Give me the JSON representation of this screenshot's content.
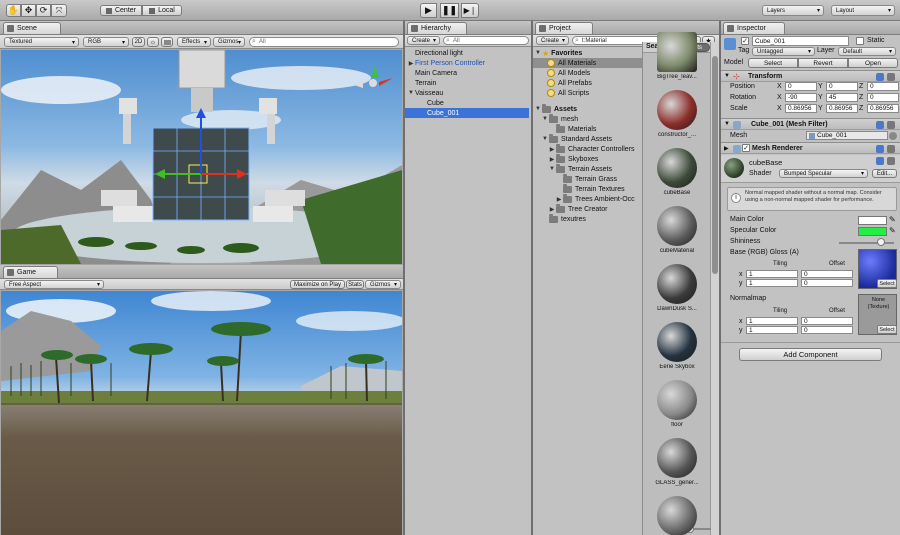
{
  "toolbar": {
    "center_btn": "Center",
    "local_btn": "Local",
    "layers": "Layers",
    "layout": "Layout"
  },
  "scene": {
    "tab": "Scene",
    "shading": "Textured",
    "render_mode": "RGB",
    "mode_2d": "2D",
    "effects": "Effects",
    "gizmos": "Gizmos",
    "search_placeholder": "All"
  },
  "game": {
    "tab": "Game",
    "aspect": "Free Aspect",
    "maximize": "Maximize on Play",
    "stats": "Stats",
    "gizmos": "Gizmos"
  },
  "hierarchy": {
    "tab": "Hierarchy",
    "create": "Create",
    "search_placeholder": "All",
    "items": [
      {
        "label": "Directional light",
        "indent": 0,
        "arrow": "",
        "blue": false
      },
      {
        "label": "First Person Controller",
        "indent": 0,
        "arrow": "▶",
        "blue": true
      },
      {
        "label": "Main Camera",
        "indent": 0,
        "arrow": "",
        "blue": false
      },
      {
        "label": "Terrain",
        "indent": 0,
        "arrow": "",
        "blue": false
      },
      {
        "label": "Vaisseau",
        "indent": 0,
        "arrow": "▼",
        "blue": false
      },
      {
        "label": "Cube",
        "indent": 1,
        "arrow": "",
        "blue": false
      },
      {
        "label": "Cube_001",
        "indent": 1,
        "arrow": "",
        "blue": false,
        "selected": true
      }
    ]
  },
  "project": {
    "tab": "Project",
    "create": "Create",
    "search_value": "t:Material",
    "search_label": "Search:",
    "assets_btn": "Assets",
    "favorites_label": "Favorites",
    "favorites": [
      "All Materials",
      "All Models",
      "All Prefabs",
      "All Scripts"
    ],
    "assets_label": "Assets",
    "tree": [
      {
        "label": "mesh",
        "indent": 1,
        "arrow": "▼"
      },
      {
        "label": "Materials",
        "indent": 2,
        "arrow": ""
      },
      {
        "label": "Standard Assets",
        "indent": 1,
        "arrow": "▼"
      },
      {
        "label": "Character Controllers",
        "indent": 2,
        "arrow": "▶"
      },
      {
        "label": "Skyboxes",
        "indent": 2,
        "arrow": "▶"
      },
      {
        "label": "Terrain Assets",
        "indent": 2,
        "arrow": "▼"
      },
      {
        "label": "Terrain Grass",
        "indent": 3,
        "arrow": ""
      },
      {
        "label": "Terrain Textures",
        "indent": 3,
        "arrow": ""
      },
      {
        "label": "Trees Ambient-Occ",
        "indent": 3,
        "arrow": "▶"
      },
      {
        "label": "Tree Creator",
        "indent": 2,
        "arrow": "▶"
      },
      {
        "label": "texutres",
        "indent": 1,
        "arrow": ""
      }
    ],
    "results": [
      {
        "label": "BigTree_leav...",
        "color": "#7e8a6a"
      },
      {
        "label": "constructor_...",
        "color": "#8b2e2a"
      },
      {
        "label": "cubeBase",
        "color": "#3d4a3a"
      },
      {
        "label": "cubeMaterial",
        "color": "#5d5d5d"
      },
      {
        "label": "DawnDusk S...",
        "color": "#3b3b3b"
      },
      {
        "label": "Eerie Skybox",
        "color": "#243240"
      },
      {
        "label": "floor",
        "color": "#8a8a8a"
      },
      {
        "label": "GLASS_gener...",
        "color": "#555555"
      },
      {
        "label": "",
        "color": "#6a6a6a"
      }
    ]
  },
  "inspector": {
    "tab": "Inspector",
    "object_name": "Cube_001",
    "static_label": "Static",
    "tag_label": "Tag",
    "tag_value": "Untagged",
    "layer_label": "Layer",
    "layer_value": "Default",
    "model_label": "Model",
    "select_btn": "Select",
    "revert_btn": "Revert",
    "open_btn": "Open",
    "transform": {
      "title": "Transform",
      "rows": [
        {
          "label": "Position",
          "x": "0",
          "y": "0",
          "z": "0"
        },
        {
          "label": "Rotation",
          "x": "-90",
          "y": "45",
          "z": "0"
        },
        {
          "label": "Scale",
          "x": "0.86956",
          "y": "0.86956",
          "z": "0.86956"
        }
      ]
    },
    "mesh_filter": {
      "title": "Cube_001 (Mesh Filter)",
      "mesh_label": "Mesh",
      "mesh_value": "Cube_001"
    },
    "mesh_renderer": {
      "title": "Mesh Renderer"
    },
    "material": {
      "name": "cubeBase",
      "shader_label": "Shader",
      "shader_value": "Bumped Specular",
      "edit_btn": "Edit...",
      "info": "Normal mapped shader without a normal map. Consider using a non-normal mapped shader for performance.",
      "main_color": "Main Color",
      "specular_color": "Specular Color",
      "shininess": "Shininess",
      "base_label": "Base (RGB) Gloss (A)",
      "tiling": "Tiling",
      "offset": "Offset",
      "x": "x",
      "y": "y",
      "base_tiling_x": "1",
      "base_tiling_y": "1",
      "base_offset_x": "0",
      "base_offset_y": "0",
      "select": "Select",
      "normalmap_label": "Normalmap",
      "normal_tiling_x": "1",
      "normal_tiling_y": "1",
      "normal_offset_x": "0",
      "normal_offset_y": "0",
      "none_texture": "None (Texture)",
      "shininess_level": 0.8,
      "main_color_hex": "#ffffff",
      "specular_color_hex": "#22ee44"
    },
    "add_component": "Add Component"
  }
}
